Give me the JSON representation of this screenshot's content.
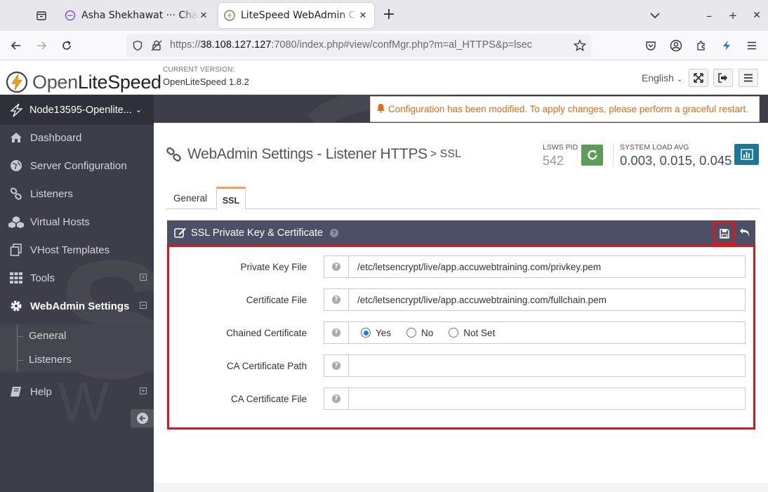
{
  "browser": {
    "tabs": [
      {
        "title": "Asha Shekhawat ··· Chat",
        "active": false
      },
      {
        "title": "LiteSpeed WebAdmin Con",
        "active": true
      }
    ],
    "url_prefix": "https://",
    "url_host": "38.108.127.127",
    "url_rest": ":7080/index.php#view/confMgr.php?m=al_HTTPS&p=lsec"
  },
  "header": {
    "logo_text_1": "Open",
    "logo_text_2": "LiteSpeed",
    "version_label": "CURRENT VERSION:",
    "version_value": "OpenLiteSpeed 1.8.2",
    "language": "English"
  },
  "sidebar": {
    "node": "Node13595-Openlite...",
    "items": [
      {
        "label": "Dashboard",
        "icon": "home-icon"
      },
      {
        "label": "Server Configuration",
        "icon": "globe-icon"
      },
      {
        "label": "Listeners",
        "icon": "link-icon"
      },
      {
        "label": "Virtual Hosts",
        "icon": "cubes-icon"
      },
      {
        "label": "VHost Templates",
        "icon": "copy-icon"
      },
      {
        "label": "Tools",
        "icon": "grid-icon"
      },
      {
        "label": "WebAdmin Settings",
        "icon": "gear-icon"
      },
      {
        "label": "Help",
        "icon": "book-icon"
      }
    ],
    "subitems": [
      "General",
      "Listeners"
    ]
  },
  "alert": "Configuration has been modified. To apply changes, please perform a graceful restart.",
  "page": {
    "title": "WebAdmin Settings - Listener HTTPS",
    "subtitle": "> SSL",
    "pid_label": "LSWS PID",
    "pid_value": "542",
    "load_label": "SYSTEM LOAD AVG",
    "load_value": "0.003, 0.015, 0.045",
    "tabs": [
      "General",
      "SSL"
    ]
  },
  "panel": {
    "title": "SSL Private Key & Certificate",
    "rows": [
      {
        "label": "Private Key File",
        "value": "/etc/letsencrypt/live/app.accuwebtraining.com/privkey.pem"
      },
      {
        "label": "Certificate File",
        "value": "/etc/letsencrypt/live/app.accuwebtraining.com/fullchain.pem"
      },
      {
        "label": "Chained Certificate",
        "value": ""
      },
      {
        "label": "CA Certificate Path",
        "value": ""
      },
      {
        "label": "CA Certificate File",
        "value": ""
      }
    ],
    "chained_options": [
      "Yes",
      "No",
      "Not Set"
    ],
    "chained_selected": "Yes"
  },
  "colors": {
    "sidebar_bg": "#3d3e4a",
    "panel_header": "#4b5067",
    "highlight_red": "#e0141b",
    "alert_orange": "#e06a16",
    "restart_green": "#5d9c59",
    "chart_blue": "#1d7796"
  }
}
